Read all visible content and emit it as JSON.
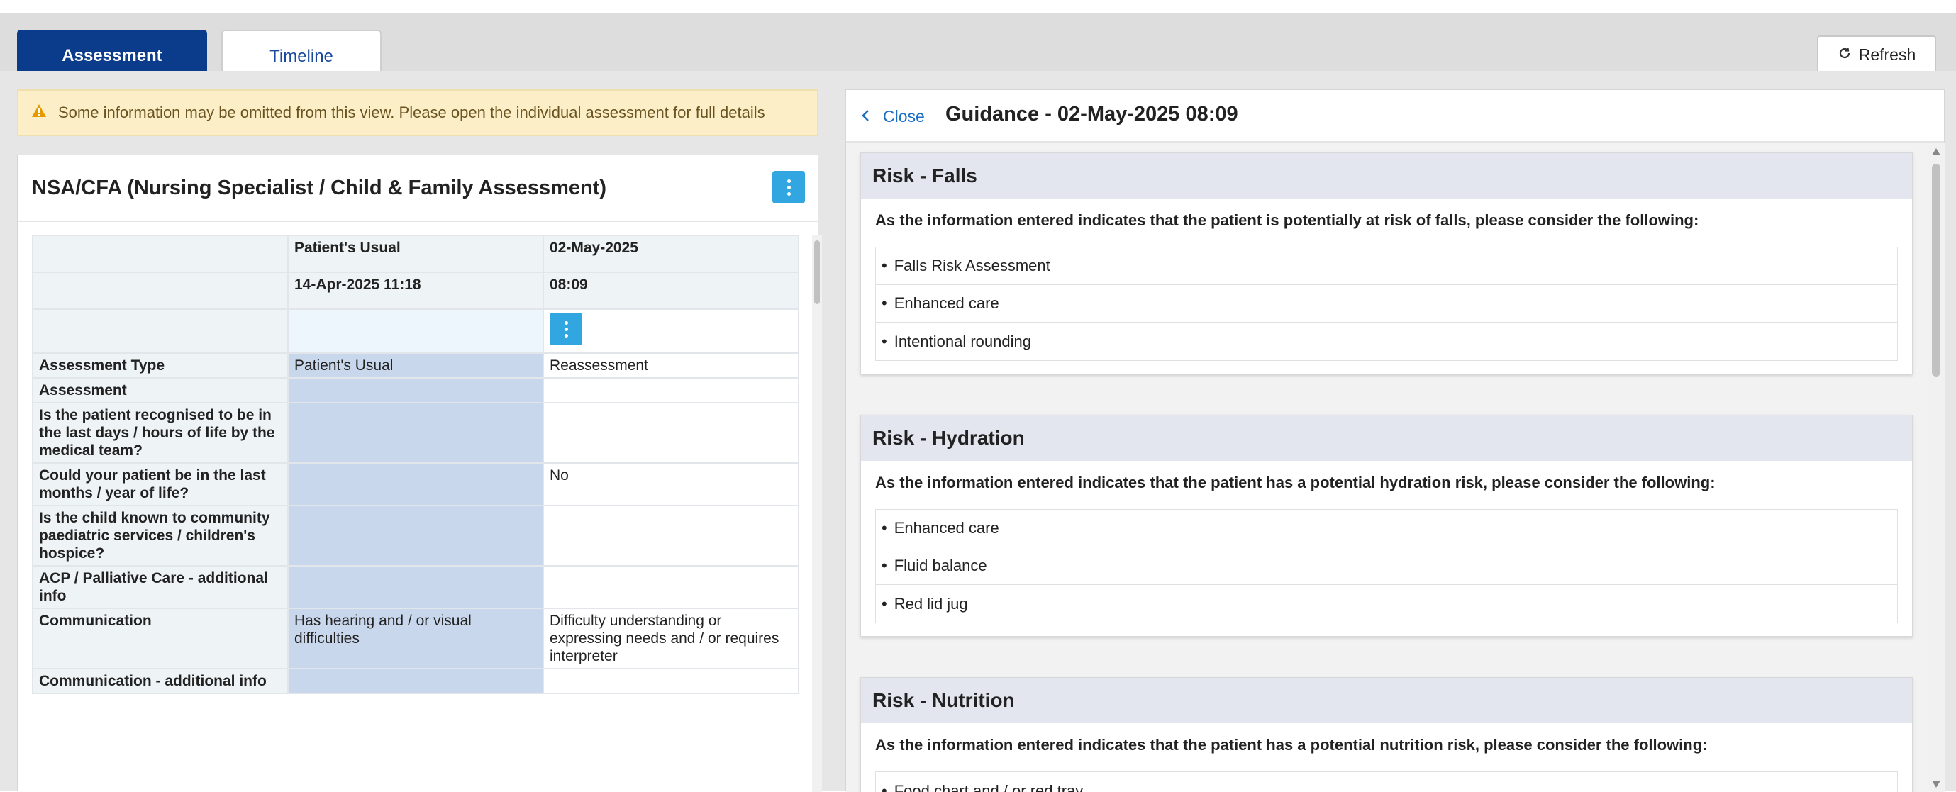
{
  "tabs": [
    {
      "label": "Assessment",
      "active": true
    },
    {
      "label": "Timeline",
      "active": false
    }
  ],
  "toolbar": {
    "refresh_label": "Refresh",
    "refresh_icon": "refresh-icon"
  },
  "warning": {
    "icon": "warning-icon",
    "text": "Some information may be omitted from this view. Please open the individual assessment for full details"
  },
  "assessment": {
    "title": "NSA/CFA (Nursing Specialist / Child & Family Assessment)",
    "columns": {
      "usual_line1": "Patient's Usual",
      "usual_line2": "14-Apr-2025 11:18",
      "current_line1": "02-May-2025",
      "current_line2": "08:09"
    },
    "rows": [
      {
        "label": "Assessment Type",
        "usual": "Patient's Usual",
        "current": "Reassessment"
      },
      {
        "label": "Assessment",
        "usual": "",
        "current": ""
      },
      {
        "label": "Is the patient recognised to be in the last days / hours of life by the medical team?",
        "usual": "",
        "current": ""
      },
      {
        "label": "Could your patient be in the last months / year of life?",
        "usual": "",
        "current": "No"
      },
      {
        "label": "Is the child known to community paediatric services / children's hospice?",
        "usual": "",
        "current": ""
      },
      {
        "label": "ACP / Palliative Care - additional info",
        "usual": "",
        "current": ""
      },
      {
        "label": "Communication",
        "usual": "Has hearing and / or visual difficulties",
        "current": "Difficulty understanding or expressing needs and / or requires interpreter"
      },
      {
        "label": "Communication - additional info",
        "usual": "",
        "current": ""
      }
    ]
  },
  "guidance": {
    "close_label": "Close",
    "title": "Guidance - 02-May-2025 08:09",
    "cards": [
      {
        "heading": "Risk - Falls",
        "description": "As the information entered indicates that the patient is potentially at risk of falls, please consider the following:",
        "items": [
          "Falls Risk Assessment",
          "Enhanced care",
          "Intentional rounding"
        ]
      },
      {
        "heading": "Risk - Hydration",
        "description": "As the information entered indicates that the patient has a potential hydration risk, please consider the following:",
        "items": [
          "Enhanced care",
          "Fluid balance",
          "Red lid jug"
        ]
      },
      {
        "heading": "Risk - Nutrition",
        "description": "As the information entered indicates that the patient has a potential nutrition risk, please consider the following:",
        "items": [
          "Food chart and / or red tray"
        ]
      }
    ]
  }
}
